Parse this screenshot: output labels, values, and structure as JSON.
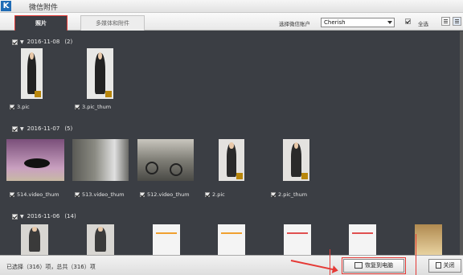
{
  "app": {
    "title": "微信附件",
    "logo_letter": "K"
  },
  "tabs": [
    {
      "label": "照片",
      "active": true
    },
    {
      "label": "多媒体和附件",
      "active": false
    }
  ],
  "toolbar": {
    "account_label": "选择微信账户",
    "account_value": "Cherish",
    "select_all_label": "全选",
    "select_all_checked": true
  },
  "groups": [
    {
      "date": "2016-11-08",
      "count": "(2)",
      "items": [
        {
          "name": "3.pic",
          "thumb": "person"
        },
        {
          "name": "3.pic_thum",
          "thumb": "person"
        }
      ]
    },
    {
      "date": "2016-11-07",
      "count": "(5)",
      "items": [
        {
          "name": "514.video_thum",
          "thumb": "video-desk"
        },
        {
          "name": "513.video_thum",
          "thumb": "video-window"
        },
        {
          "name": "512.video_thum",
          "thumb": "video-bikes"
        },
        {
          "name": "2.pic",
          "thumb": "person-red"
        },
        {
          "name": "2.pic_thum",
          "thumb": "person-red"
        }
      ]
    },
    {
      "date": "2016-11-06",
      "count": "(14)",
      "items": [
        {
          "name": "",
          "thumb": "person-dark"
        },
        {
          "name": "",
          "thumb": "person-dark"
        },
        {
          "name": "",
          "thumb": "screenshot"
        },
        {
          "name": "",
          "thumb": "screenshot"
        },
        {
          "name": "",
          "thumb": "screenshot"
        },
        {
          "name": "",
          "thumb": "screenshot"
        },
        {
          "name": "",
          "thumb": "food"
        }
      ]
    }
  ],
  "status": {
    "text": "已选择（316）项，总共（316）项"
  },
  "buttons": {
    "restore": "恢复到电脑",
    "close": "关闭"
  },
  "colors": {
    "background": "#3b3e44",
    "highlight": "#e53935",
    "brand": "#1f6bb5"
  }
}
